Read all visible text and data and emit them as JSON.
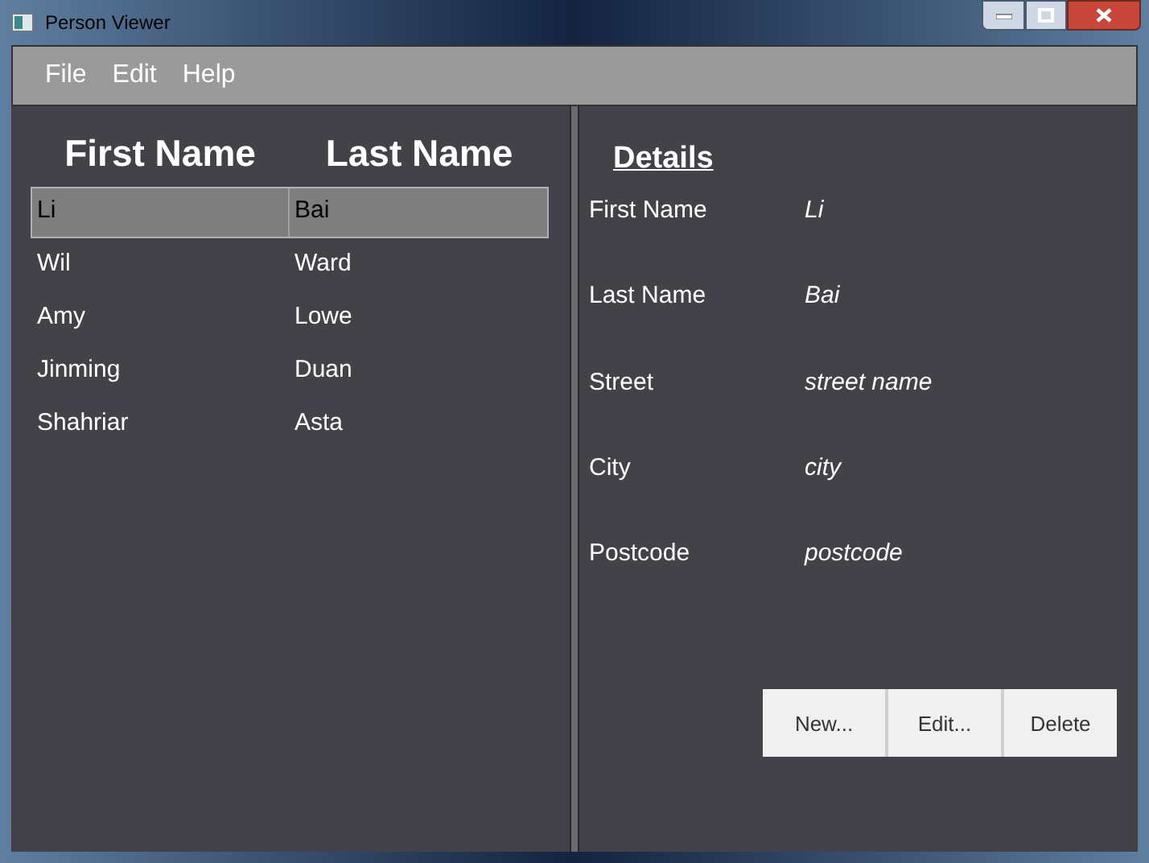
{
  "window": {
    "title": "Person Viewer"
  },
  "menu": [
    "File",
    "Edit",
    "Help"
  ],
  "table": {
    "columns": [
      "First Name",
      "Last Name"
    ],
    "rows": [
      {
        "cells": [
          "Li",
          "Bai"
        ],
        "selected": true
      },
      {
        "cells": [
          "Wil",
          "Ward"
        ],
        "selected": false
      },
      {
        "cells": [
          "Amy",
          "Lowe"
        ],
        "selected": false
      },
      {
        "cells": [
          "Jinming",
          "Duan"
        ],
        "selected": false
      },
      {
        "cells": [
          "Shahriar",
          "Asta"
        ],
        "selected": false
      }
    ]
  },
  "details": {
    "title": "Details",
    "fields": [
      {
        "label": "First Name",
        "value": "Li"
      },
      {
        "label": "Last Name",
        "value": "Bai"
      },
      {
        "label": "Street",
        "value": "street name"
      },
      {
        "label": "City",
        "value": "city"
      },
      {
        "label": "Postcode",
        "value": "postcode"
      }
    ]
  },
  "buttons": [
    "New...",
    "Edit...",
    "Delete"
  ]
}
